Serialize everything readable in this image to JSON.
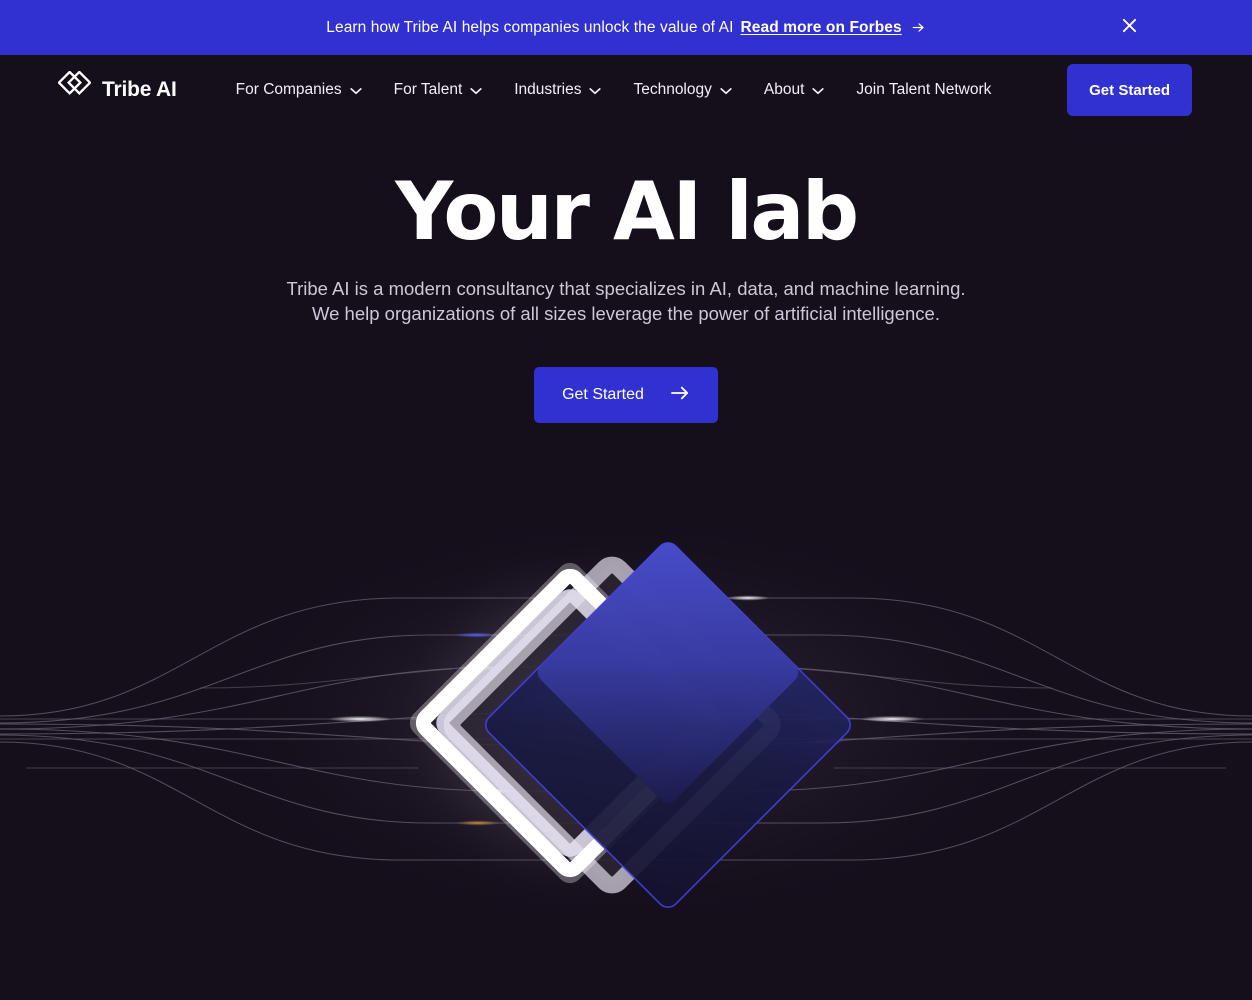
{
  "banner": {
    "message": "Learn how Tribe AI helps companies unlock the value of AI",
    "link_label": "Read more on Forbes",
    "arrow_icon": "arrow-right-icon",
    "close_icon": "close-icon",
    "background_color": "#3130d0"
  },
  "nav": {
    "brand": {
      "name": "Tribe AI",
      "logo_icon": "tribe-diamonds-logo-icon"
    },
    "items": [
      {
        "label": "For Companies",
        "has_dropdown": true,
        "icon": "chevron-down-icon"
      },
      {
        "label": "For Talent",
        "has_dropdown": true,
        "icon": "chevron-down-icon"
      },
      {
        "label": "Industries",
        "has_dropdown": true,
        "icon": "chevron-down-icon"
      },
      {
        "label": "Technology",
        "has_dropdown": true,
        "icon": "chevron-down-icon"
      },
      {
        "label": "About",
        "has_dropdown": true,
        "icon": "chevron-down-icon"
      },
      {
        "label": "Join Talent Network",
        "has_dropdown": false,
        "icon": ""
      }
    ],
    "cta_label": "Get Started",
    "cta_color": "#3130d0"
  },
  "hero": {
    "title": "Your AI lab",
    "subtitle_line1": "Tribe AI is a modern consultancy that specializes in AI, data, and machine learning.",
    "subtitle_line2": "We help organizations of all sizes leverage the power of artificial intelligence.",
    "cta_label": "Get Started",
    "cta_arrow_icon": "arrow-right-icon",
    "cta_color": "#3130d0"
  },
  "graphic": {
    "name": "hero-diamond-network-graphic",
    "description": "Two overlapping rotated squares with glow over a fanning line network",
    "colors": {
      "background": "#150e1b",
      "white_diamond": "#ffffff",
      "gray_diamond": "#b9b4c2",
      "blue_diamond": "#3f45b5",
      "blue_diamond_edge": "#4240e0",
      "line": "#6d6478"
    }
  }
}
